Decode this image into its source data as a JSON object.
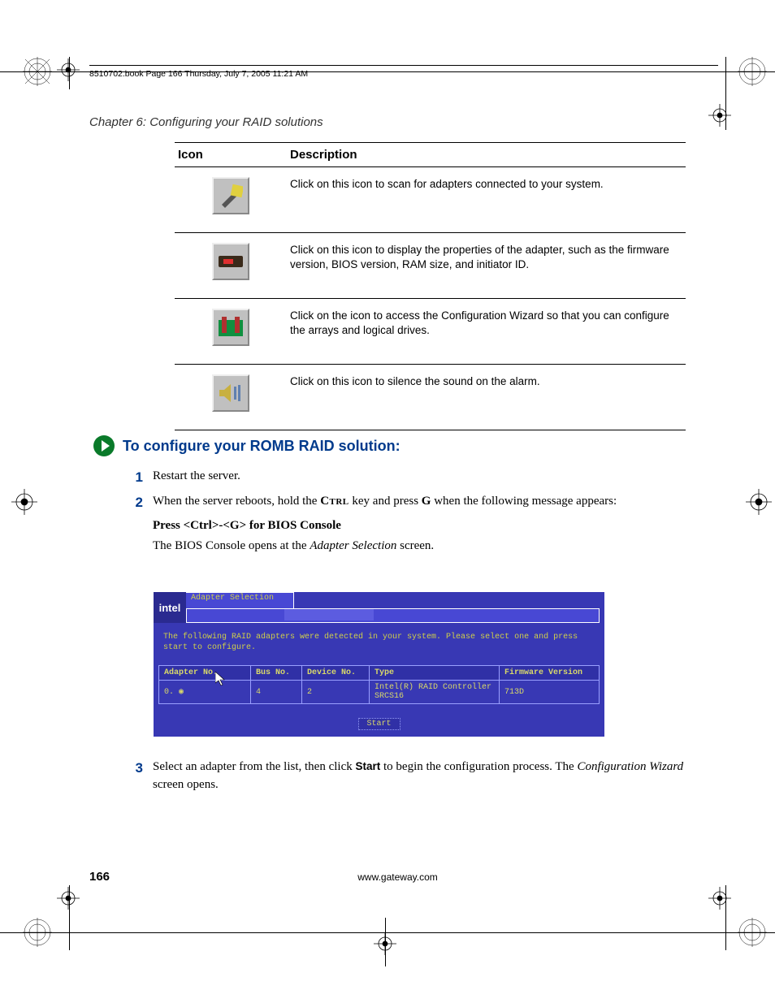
{
  "header": {
    "running": "8510702.book  Page 166  Thursday, July 7, 2005  11:21 AM"
  },
  "chapter_title": "Chapter 6: Configuring your RAID solutions",
  "icon_table": {
    "headers": {
      "icon": "Icon",
      "description": "Description"
    },
    "rows": [
      {
        "description": "Click on this icon to scan for adapters connected to your system."
      },
      {
        "description": "Click on this icon to display the properties of the adapter, such as the firmware version, BIOS version, RAM size, and initiator ID."
      },
      {
        "description": "Click on the icon to access the Configuration Wizard so that you can configure the arrays and logical drives."
      },
      {
        "description": "Click on this icon to silence the sound on the alarm."
      }
    ]
  },
  "section_heading": "To configure your ROMB RAID solution:",
  "steps": {
    "s1": "Restart the server.",
    "s2_a": "When the server reboots, hold the ",
    "s2_ctrl": "Ctrl",
    "s2_b": " key and press ",
    "s2_g": "G",
    "s2_c": " when the following message appears:",
    "s2_substep": "Press <Ctrl>-<G> for BIOS Console",
    "s2_body_a": "The BIOS Console opens at the ",
    "s2_body_i": "Adapter Selection",
    "s2_body_b": " screen.",
    "s3_a": "Select an adapter from the list, then click ",
    "s3_start": "Start",
    "s3_b": " to begin the configuration process. The ",
    "s3_i": "Configuration Wizard",
    "s3_c": " screen opens."
  },
  "bios": {
    "logo": "intel",
    "title": "Adapter Selection",
    "message": "The following RAID adapters were detected in your system. Please select one and press start to configure.",
    "headers": {
      "adapter": "Adapter No.",
      "bus": "Bus No.",
      "device": "Device No.",
      "type": "Type",
      "fw": "Firmware Version"
    },
    "row": {
      "adapter": "0.",
      "bus": "4",
      "device": "2",
      "type": "Intel(R) RAID Controller SRCS16",
      "fw": "713D"
    },
    "start_btn": "Start"
  },
  "footer": {
    "page": "166",
    "url": "www.gateway.com"
  }
}
